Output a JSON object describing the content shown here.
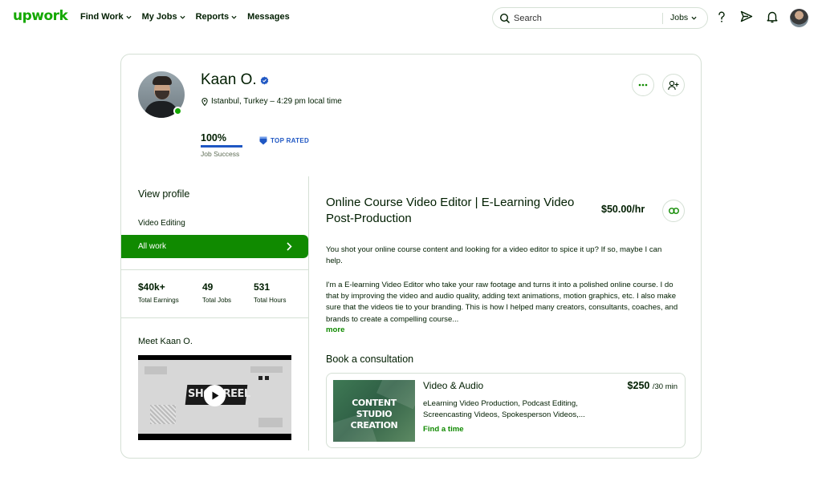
{
  "nav": {
    "logo": "upwork",
    "links": [
      "Find Work",
      "My Jobs",
      "Reports",
      "Messages"
    ],
    "search_placeholder": "Search",
    "search_scope": "Jobs",
    "icons": [
      "help-icon",
      "send-icon",
      "bell-icon"
    ]
  },
  "profile": {
    "name": "Kaan O.",
    "location": "Istanbul, Turkey – 4:29 pm local time",
    "job_success_value": "100%",
    "job_success_fraction": 1.0,
    "job_success_label": "Job Success",
    "badge": "TOP RATED"
  },
  "sidebar": {
    "view_profile": "View profile",
    "specialty": "Video Editing",
    "all_work": "All work",
    "stats": [
      {
        "value": "$40k+",
        "label": "Total Earnings"
      },
      {
        "value": "49",
        "label": "Total Jobs"
      },
      {
        "value": "531",
        "label": "Total Hours"
      }
    ],
    "meet": "Meet Kaan O.",
    "video_title": "SHOWREEL"
  },
  "main": {
    "title": "Online Course Video Editor | E-Learning Video Post-Production",
    "rate": "$50.00/hr",
    "intro": "You shot your online course content and looking for a video editor to spice it up? If so, maybe I can help.",
    "body": "I'm a E-learning Video Editor who take your raw footage and turns it into a polished online course. I do that by improving the video and audio quality, adding text animations, motion graphics, etc. I also make sure that the videos tie to your branding. This is how I helped many creators, consultants, coaches, and brands to create a compelling course...",
    "more": "more",
    "book_title": "Book a consultation",
    "consultation": {
      "thumb_text": "CONTENT STUDIO CREATION",
      "category": "Video & Audio",
      "price": "$250",
      "price_unit": "/30 min",
      "description": "eLearning Video Production, Podcast Editing, Screencasting Videos, Spokesperson Videos,...",
      "cta": "Find a time"
    }
  },
  "colors": {
    "brand_green": "#14a800",
    "button_green": "#108a00",
    "badge_blue": "#1f57c3",
    "text": "#001e00",
    "border": "#d5e0d5"
  }
}
